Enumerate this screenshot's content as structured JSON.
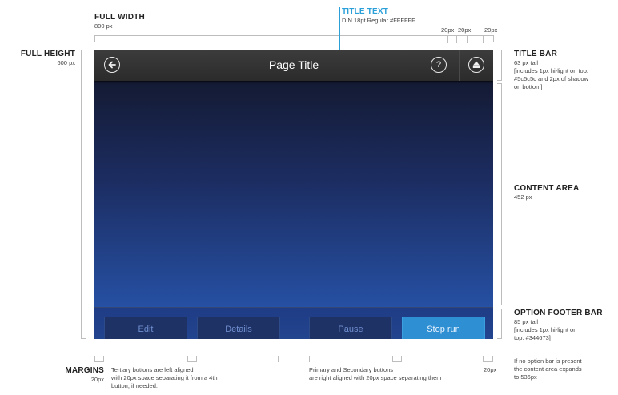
{
  "annotations": {
    "full_width": {
      "heading": "FULL WIDTH",
      "value": "800 px"
    },
    "full_height": {
      "heading": "FULL HEIGHT",
      "value": "600 px"
    },
    "title_text": {
      "heading": "TITLE TEXT",
      "value": "DIN 18pt Regular #FFFFFF"
    },
    "top_margins": [
      "20px",
      "20px",
      "20px"
    ],
    "title_bar": {
      "heading": "TITLE BAR",
      "lines": [
        "63 px tall",
        "[includes 1px hi-light on top:",
        "#5c5c5c and 2px of shadow",
        "on bottom]"
      ]
    },
    "content_area": {
      "heading": "CONTENT AREA",
      "value": "452 px"
    },
    "option_footer_bar": {
      "heading": "OPTION FOOTER BAR",
      "lines": [
        "85 px tall",
        "[includes 1px hi-light on",
        "top: #344673]"
      ]
    },
    "footer_note": [
      "If no option bar is present",
      "the content area expands",
      "to 536px"
    ],
    "margins": {
      "heading": "MARGINS",
      "value": "20px"
    },
    "right_margin": "20px",
    "tertiary_note": [
      "Tertiary buttons are left aligned",
      "with 20px space separating it from a 4th",
      "button, if needed."
    ],
    "primary_note": [
      "Primary  and Secondary buttons",
      "are right aligned with 20px space separating them"
    ]
  },
  "screen": {
    "title": "Page Title",
    "back_icon": "back-arrow-circle-icon",
    "help_icon": "question-circle-icon",
    "eject_icon": "eject-circle-icon",
    "footer_buttons": [
      {
        "label": "Edit",
        "type": "tertiary"
      },
      {
        "label": "Details",
        "type": "tertiary"
      },
      {
        "label": "Pause",
        "type": "secondary"
      },
      {
        "label": "Stop run",
        "type": "primary"
      }
    ]
  },
  "colors": {
    "title_text": "#FFFFFF",
    "title_highlight": "#5c5c5c",
    "footer_highlight": "#344673",
    "annotation_accent": "#2a9fd8",
    "primary_button": "#2f8fd3"
  }
}
